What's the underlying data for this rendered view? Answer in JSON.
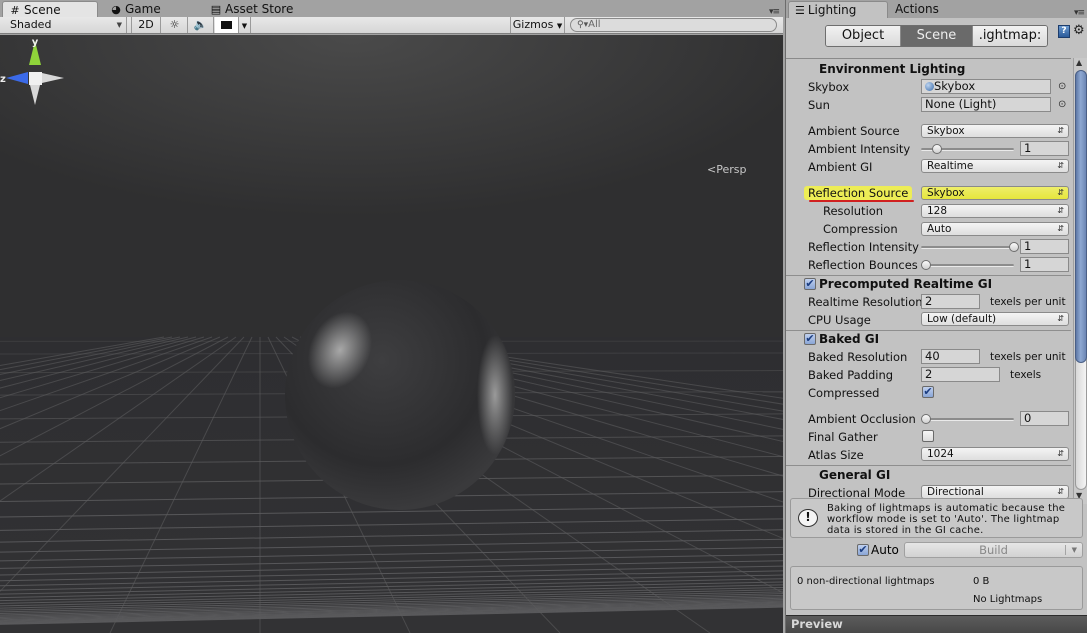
{
  "scene_window": {
    "tabs": [
      {
        "label": "Scene",
        "icon": "grid-icon",
        "active": true
      },
      {
        "label": "Game",
        "icon": "pacman-icon",
        "active": false
      },
      {
        "label": "Asset Store",
        "icon": "shopping-bag-icon",
        "active": false
      }
    ],
    "toolbar": {
      "draw_mode": "Shaded",
      "mode_2d": "2D",
      "lighting_toggle_icon": "sun-icon",
      "audio_toggle_icon": "speaker-icon",
      "effects_toggle_icon": "image-icon",
      "gizmos_label": "Gizmos",
      "search_placeholder": "All"
    },
    "viewport": {
      "gizmo_axes": {
        "y": "y",
        "z": "z"
      },
      "projection_label": "Persp"
    }
  },
  "lighting_window": {
    "tabs": [
      {
        "label": "Lighting",
        "icon": "sliders-icon",
        "active": true
      },
      {
        "label": "Actions",
        "active": false
      }
    ],
    "segments": [
      {
        "label": "Object",
        "selected": false
      },
      {
        "label": "Scene",
        "selected": true
      },
      {
        "label": "Lightmaps",
        "display": ".ightmap:",
        "selected": false
      }
    ],
    "environment": {
      "header": "Environment Lighting",
      "skybox_label": "Skybox",
      "skybox_value": "Skybox",
      "sun_label": "Sun",
      "sun_value": "None (Light)",
      "ambient_source_label": "Ambient Source",
      "ambient_source_value": "Skybox",
      "ambient_intensity_label": "Ambient Intensity",
      "ambient_intensity_value": "1",
      "ambient_intensity_fraction": 0.125,
      "ambient_gi_label": "Ambient GI",
      "ambient_gi_value": "Realtime",
      "reflection_source_label": "Reflection Source",
      "reflection_source_value": "Skybox",
      "resolution_label": "Resolution",
      "resolution_value": "128",
      "compression_label": "Compression",
      "compression_value": "Auto",
      "reflection_intensity_label": "Reflection Intensity",
      "reflection_intensity_value": "1",
      "reflection_intensity_fraction": 1.0,
      "reflection_bounces_label": "Reflection Bounces",
      "reflection_bounces_value": "1",
      "reflection_bounces_fraction": 0.0
    },
    "precomputed_gi": {
      "header": "Precomputed Realtime GI",
      "enabled": true,
      "realtime_resolution_label": "Realtime Resolution",
      "realtime_resolution_value": "2",
      "realtime_resolution_unit": "texels per unit",
      "cpu_usage_label": "CPU Usage",
      "cpu_usage_value": "Low (default)"
    },
    "baked_gi": {
      "header": "Baked GI",
      "enabled": true,
      "baked_resolution_label": "Baked Resolution",
      "baked_resolution_value": "40",
      "baked_resolution_unit": "texels per unit",
      "baked_padding_label": "Baked Padding",
      "baked_padding_value": "2",
      "baked_padding_unit": "texels",
      "compressed_label": "Compressed",
      "compressed": true,
      "ambient_occlusion_label": "Ambient Occlusion",
      "ambient_occlusion_value": "0",
      "ambient_occlusion_fraction": 0.0,
      "final_gather_label": "Final Gather",
      "final_gather": false,
      "atlas_size_label": "Atlas Size",
      "atlas_size_value": "1024"
    },
    "general_gi": {
      "header": "General GI",
      "directional_mode_label": "Directional Mode",
      "directional_mode_value": "Directional"
    },
    "info_message": "Baking of lightmaps is automatic because the workflow mode is set to 'Auto'. The lightmap data is stored in the GI cache.",
    "auto_label": "Auto",
    "auto_checked": true,
    "build_label": "Build",
    "lightmaps": {
      "count_text": "0 non-directional lightmaps",
      "size_text": "0 B",
      "status_text": "No Lightmaps"
    },
    "preview_label": "Preview",
    "highlight_color": "#eded56",
    "underline_color": "#d02020"
  }
}
